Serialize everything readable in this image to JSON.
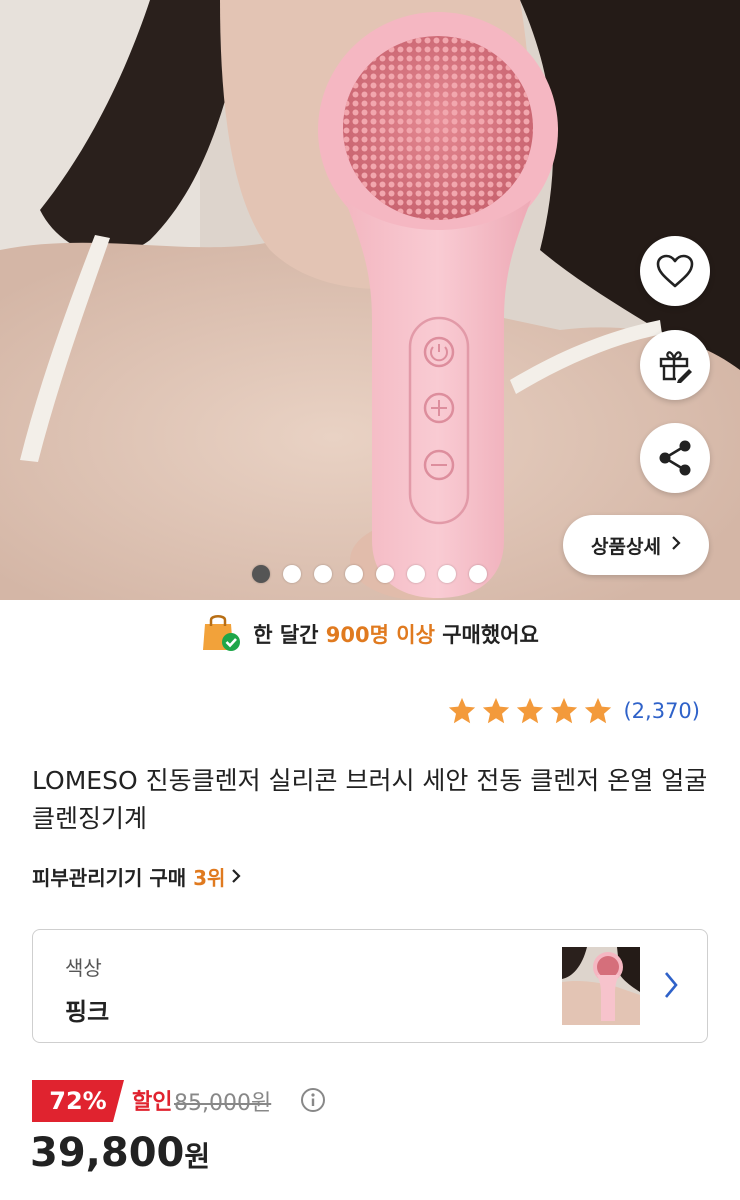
{
  "hero": {
    "image": "product-photo-pink-silicone-facial-cleansing-brush",
    "actions": {
      "wishlist_icon": "heart-icon",
      "gift_icon": "gift-icon",
      "share_icon": "share-icon"
    },
    "detail_button_label": "상품상세",
    "carousel": {
      "total": 8,
      "current": 1
    }
  },
  "banner": {
    "icon": "shopping-bag-check-icon",
    "prefix": "한 달간 ",
    "highlight": "900명 이상",
    "suffix": " 구매했어요"
  },
  "rating": {
    "stars": 5,
    "review_count": "(2,370)"
  },
  "product": {
    "title": "LOMESO 진동클렌저 실리콘 브러시 세안 전동 클렌저 온열 얼굴클렌징기계",
    "rank": {
      "prefix": "피부관리기기 구매 ",
      "number": "3위"
    }
  },
  "option": {
    "label": "색상",
    "value": "핑크"
  },
  "price": {
    "discount": "72%",
    "sale_word": "할인",
    "original": "85,000원",
    "amount": "39,800",
    "unit": "원"
  },
  "colors": {
    "accent_orange": "#e07a1f",
    "sale_red": "#e0232f",
    "link_blue": "#2f62c9",
    "star_orange": "#f39a3b"
  }
}
